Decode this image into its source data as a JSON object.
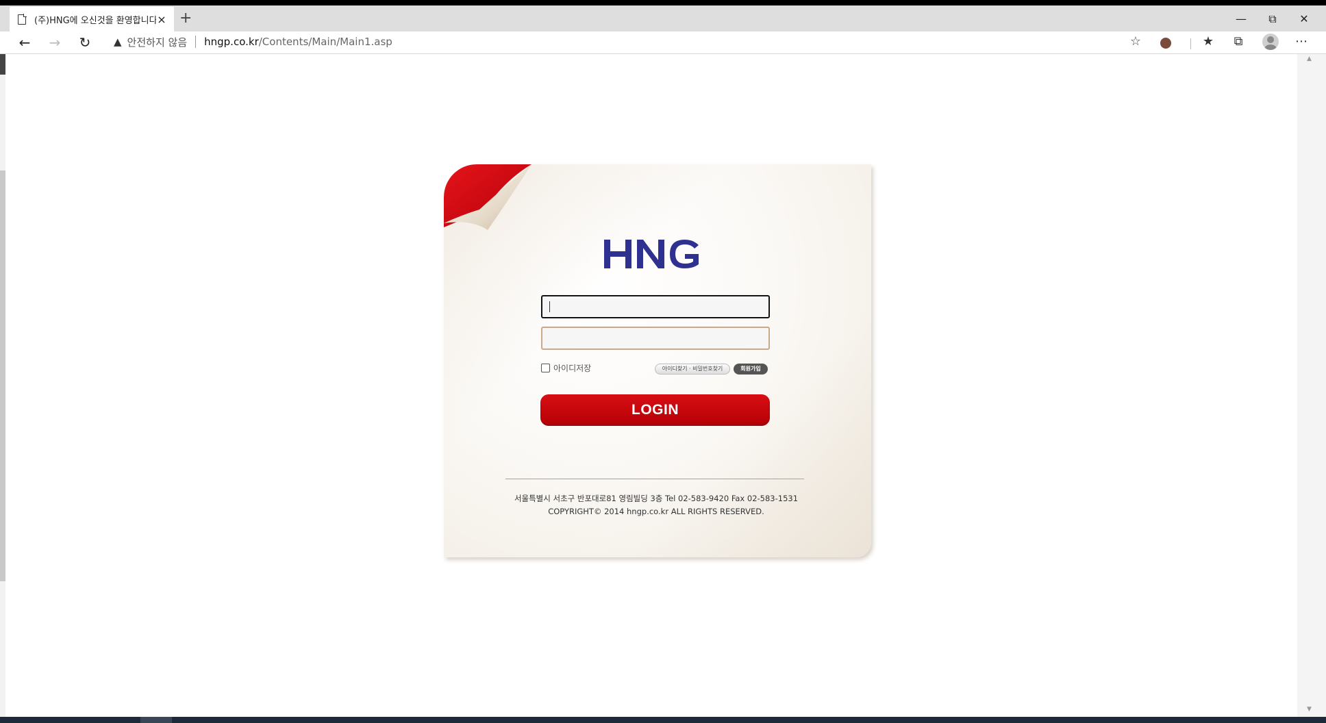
{
  "browser": {
    "tab_title": "(주)HNG에 오신것을 환영합니다",
    "tab_close": "×",
    "new_tab": "+",
    "security_label": "안전하지 않음",
    "url_host": "hngp.co.kr",
    "url_path": "/Contents/Main/Main1.asp"
  },
  "login": {
    "logo_text": "HNG",
    "remember_label": "아이디저장",
    "find_label": "아이디찾기 · 비밀번호찾기",
    "join_label": "회원가입",
    "login_label": "LOGIN",
    "id_value": "",
    "pw_value": ""
  },
  "footer": {
    "address": "서울특별시 서초구 반포대로81 영림빌딩 3층 Tel 02-583-9420 Fax 02-583-1531",
    "copyright": "COPYRIGHT© 2014 hngp.co.kr ALL RIGHTS RESERVED."
  },
  "colors": {
    "accent_red": "#c3060c",
    "logo_blue": "#2f3190"
  }
}
